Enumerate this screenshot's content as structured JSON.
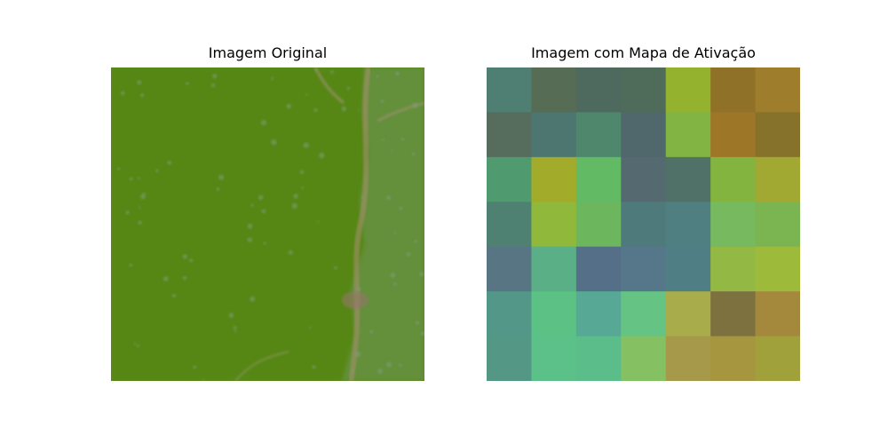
{
  "panels": {
    "left_title": "Imagem Original",
    "right_title": "Imagem com Mapa de Ativação"
  },
  "activation_map": {
    "rows": 7,
    "cols": 7,
    "colors": [
      [
        "#4f7f72",
        "#566c55",
        "#4e6a5e",
        "#4f6b5a",
        "#95b22f",
        "#8f7228",
        "#9e7d2c"
      ],
      [
        "#566c5d",
        "#4d7670",
        "#4f876d",
        "#50676c",
        "#82b444",
        "#9e7628",
        "#86722b"
      ],
      [
        "#4f9a6f",
        "#a2ab2a",
        "#62bb64",
        "#546a70",
        "#4f7168",
        "#82b43f",
        "#a2a933"
      ],
      [
        "#4f8172",
        "#90b93b",
        "#6cb65e",
        "#4f7a7c",
        "#4f7f80",
        "#76b95f",
        "#7bb551"
      ],
      [
        "#577583",
        "#5aaf87",
        "#566f89",
        "#56778a",
        "#4f7f84",
        "#93b944",
        "#9dba3a"
      ],
      [
        "#539789",
        "#5bc184",
        "#57a995",
        "#65c383",
        "#a9ac4a",
        "#7d7140",
        "#a4893c"
      ],
      [
        "#539784",
        "#5cc089",
        "#5bbe8a",
        "#85c062",
        "#a69a4a",
        "#a6963f",
        "#a1a13c"
      ]
    ]
  },
  "original_image": {
    "description_colors": {
      "leaf": "#5a8c18",
      "leaf_dark": "#4e7f10",
      "vein": "#9b8a6a",
      "speckle": "#7aa37a"
    }
  }
}
